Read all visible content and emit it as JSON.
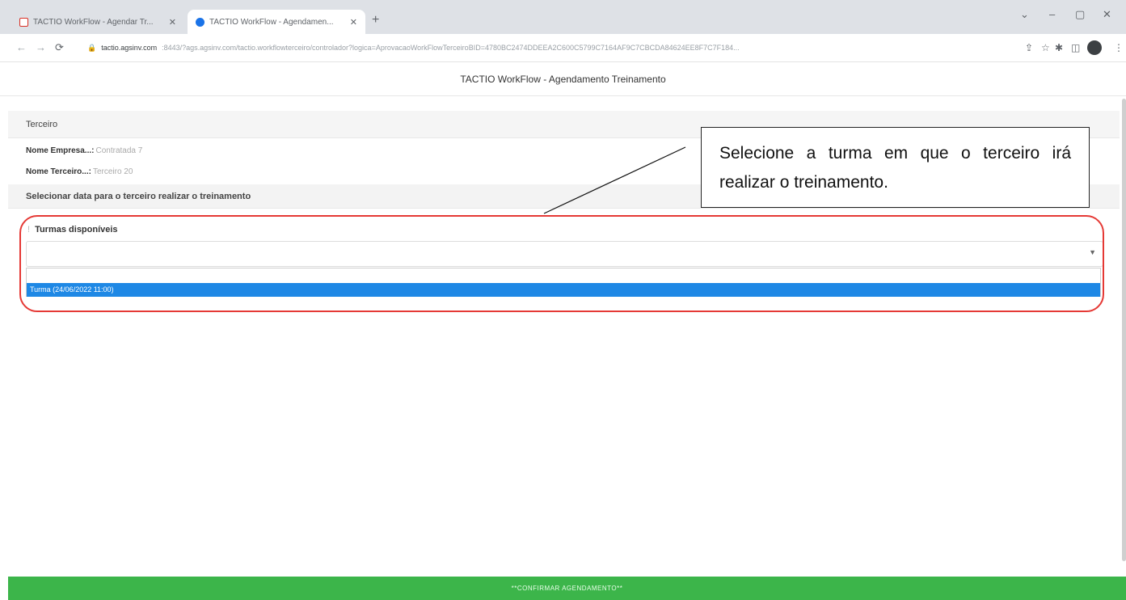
{
  "browser": {
    "tabs": [
      {
        "title": "TACTIO WorkFlow - Agendar Tr...",
        "close": "✕"
      },
      {
        "title": "TACTIO WorkFlow - Agendamen...",
        "close": "✕"
      }
    ],
    "new_tab": "+",
    "window_controls": {
      "chevron": "⌄",
      "minimize": "–",
      "maximize": "▢",
      "close": "✕"
    },
    "nav": {
      "back": "←",
      "forward": "→",
      "reload": "⟳"
    },
    "address": {
      "lock": "🔒",
      "host": "tactio.agsinv.com",
      "rest": ":8443/?ags.agsinv.com/tactio.workflowterceiro/controlador?logica=AprovacaoWorkFlowTerceiroBID=4780BC2474DDEEA2C600C5799C7164AF9C7CBCDA84624EE8F7C7F184..."
    },
    "toolbar_icons": {
      "share": "⇪",
      "star": "☆",
      "extensions": "✱",
      "sidepanel": "◫",
      "menu": "⋮"
    }
  },
  "page": {
    "title": "TACTIO WorkFlow - Agendamento Treinamento",
    "section_terceiro": "Terceiro",
    "empresa_label": "Nome Empresa...:",
    "empresa_value": "Contratada 7",
    "terceiro_label": "Nome Terceiro...:",
    "terceiro_value": "Terceiro 20",
    "section_data": "Selecionar data para o terceiro realizar o treinamento",
    "turmas_tick": "!",
    "turmas_label": "Turmas disponíveis",
    "select_value": "",
    "dropdown_arrow": "▼",
    "option_selected": "Turma (24/06/2022 11:00)",
    "confirm_button": "**CONFIRMAR AGENDAMENTO**"
  },
  "annotation": {
    "callout_text": "Selecione a turma em que o terceiro irá realizar o treinamento.",
    "ring_color": "#e53935"
  },
  "colors": {
    "accent_blue": "#1e88e5",
    "confirm_green": "#3cb54a"
  }
}
